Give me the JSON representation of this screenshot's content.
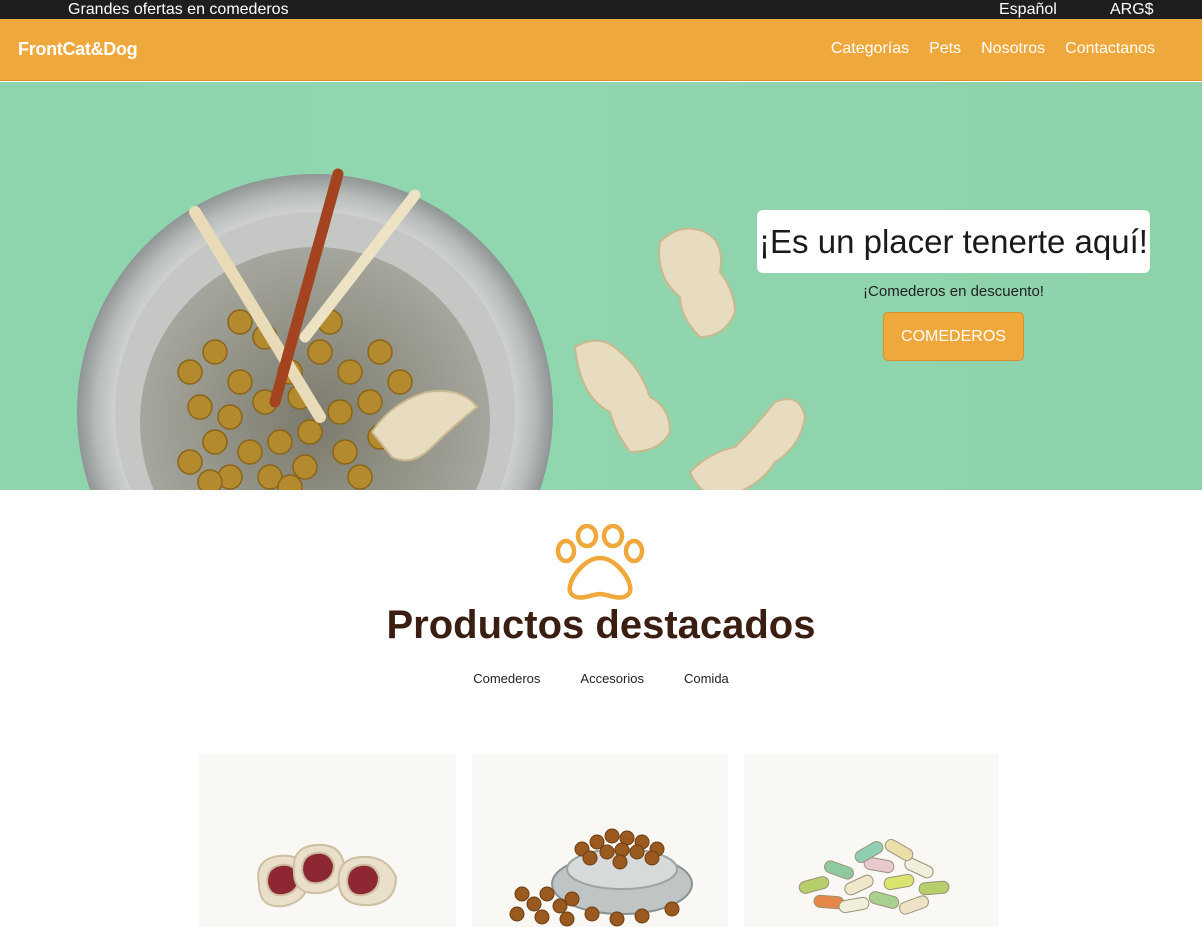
{
  "topbar": {
    "promo": "Grandes ofertas en comederos",
    "language": "Español",
    "currency": "ARG$"
  },
  "navbar": {
    "brand": "FrontCat&Dog",
    "links": [
      "Categorías",
      "Pets",
      "Nosotros",
      "Contactanos"
    ]
  },
  "hero": {
    "title": "¡Es un placer tenerte aquí!",
    "subtitle": "¡Comederos en descuento!",
    "button": "COMEDEROS"
  },
  "featured": {
    "title": "Productos destacados",
    "filters": [
      "Comederos",
      "Accesorios",
      "Comida"
    ]
  },
  "colors": {
    "accent": "#efa83b",
    "hero_bg": "#8ed4ad",
    "title": "#3a1e12",
    "topbar": "#1e1e1e"
  }
}
